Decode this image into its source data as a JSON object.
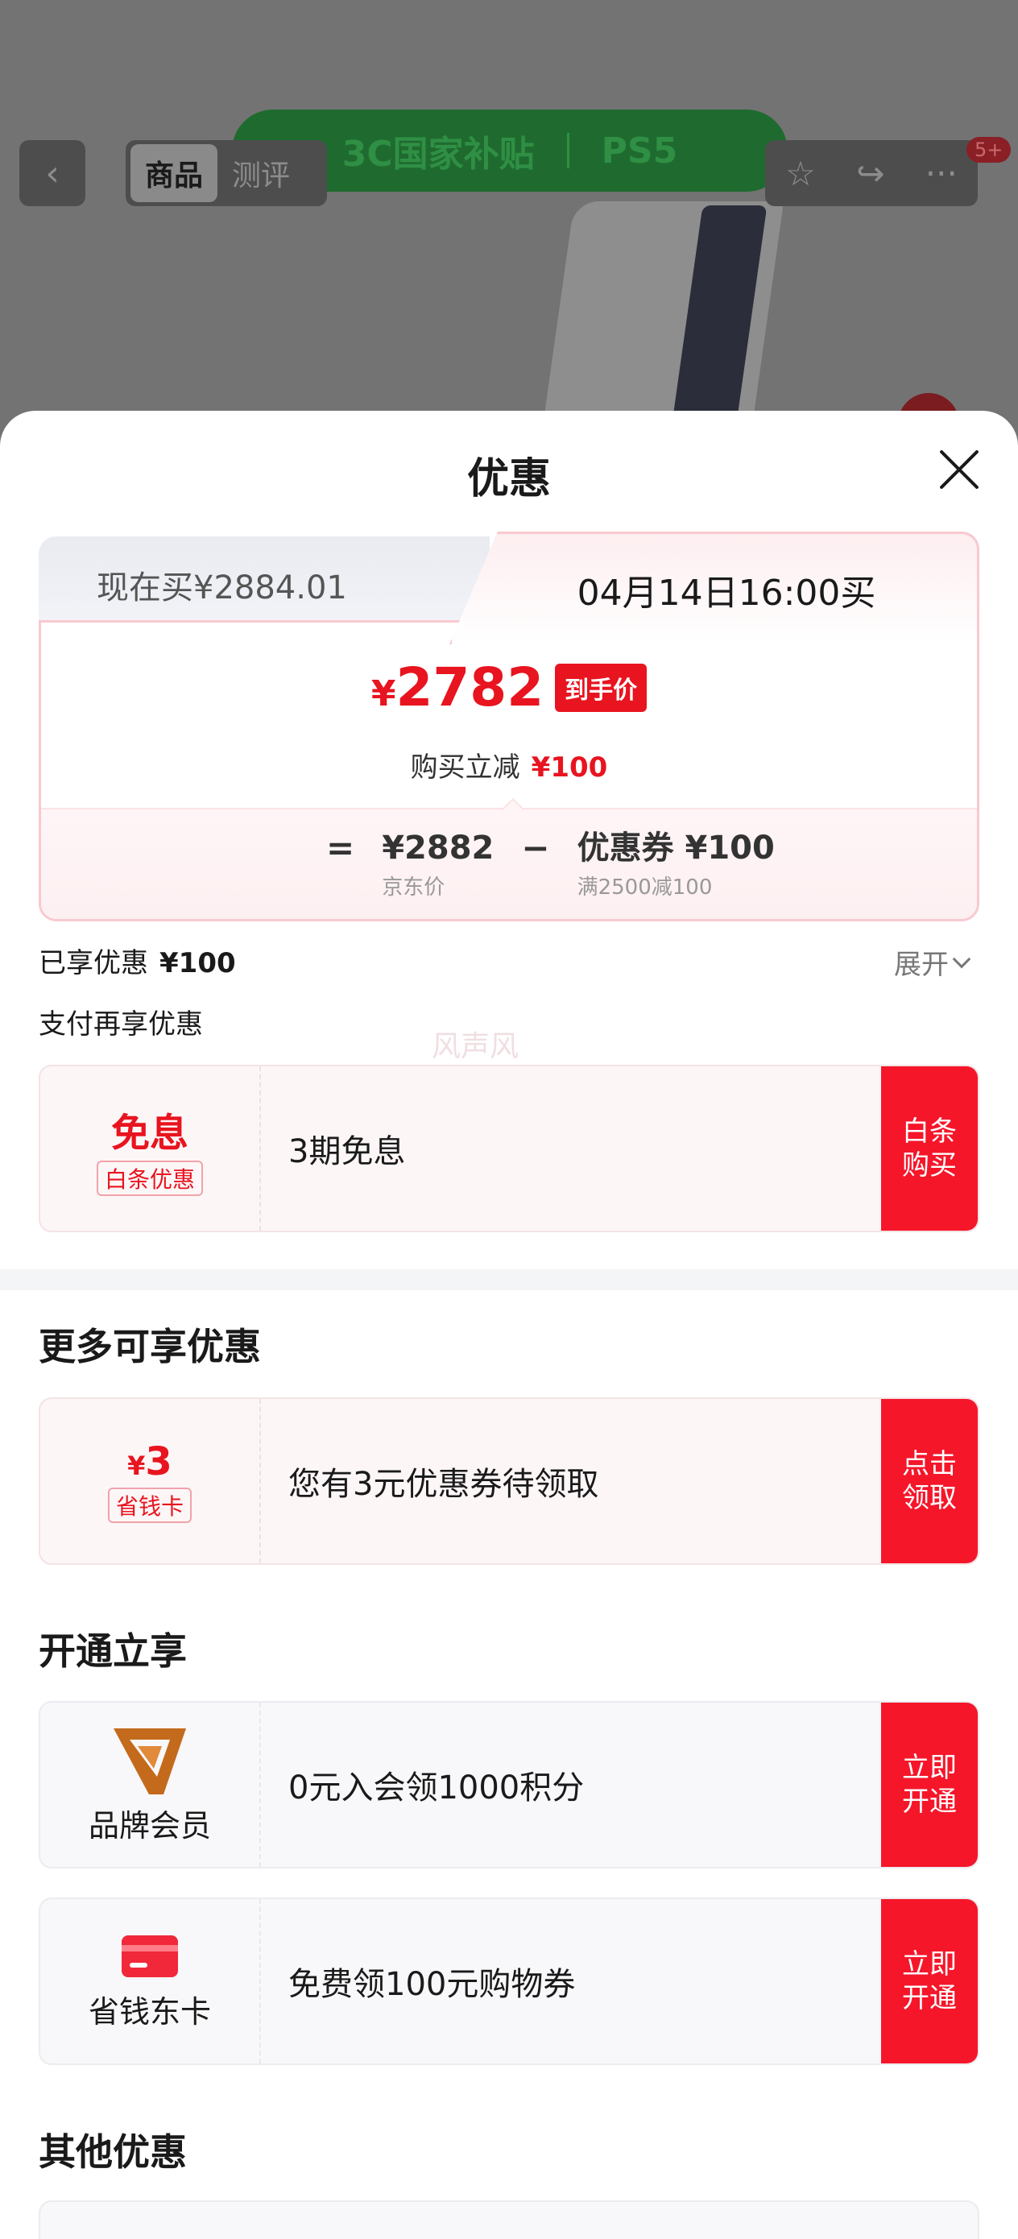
{
  "background": {
    "banner_left": "3C国家补贴",
    "banner_right": "PS5",
    "back_icon": "‹",
    "tabs": [
      "商品",
      "测评"
    ],
    "actions": [
      "☆",
      "↪",
      "···"
    ],
    "badge": "5+"
  },
  "sheet": {
    "title": "优惠",
    "price_card": {
      "tab_now": "现在买¥2884.01",
      "tab_later": "04月14日16:00买",
      "yen": "¥",
      "final_price": "2782",
      "final_tag": "到手价",
      "reduce_label": "购买立减",
      "reduce_value": "¥100",
      "formula": {
        "eq": "=",
        "jd_price": "¥2882",
        "jd_price_label": "京东价",
        "minus": "−",
        "coupon": "优惠券 ¥100",
        "coupon_rule": "满2500减100"
      }
    },
    "enjoyed": {
      "label": "已享优惠",
      "value": "¥100"
    },
    "expand_label": "展开",
    "pay_title": "支付再享优惠",
    "watermark": "风声风",
    "baitiao": {
      "title": "免息",
      "tag": "白条优惠",
      "text": "3期免息",
      "button": "白条\n购买"
    },
    "more_title": "更多可享优惠",
    "saver_coupon": {
      "yen": "¥",
      "amount": "3",
      "tag": "省钱卡",
      "text": "您有3元优惠券待领取",
      "button": "点击\n领取"
    },
    "open_title": "开通立享",
    "brand_member": {
      "name": "品牌会员",
      "text": "0元入会领1000积分",
      "button": "立即\n开通"
    },
    "saver_card": {
      "name": "省钱东卡",
      "text": "免费领100元购物券",
      "button": "立即\n开通"
    },
    "other_title": "其他优惠"
  },
  "colors": {
    "accent_red": "#e8141f",
    "button_red": "#f5162a",
    "brand_orange": "#c46a1c"
  }
}
